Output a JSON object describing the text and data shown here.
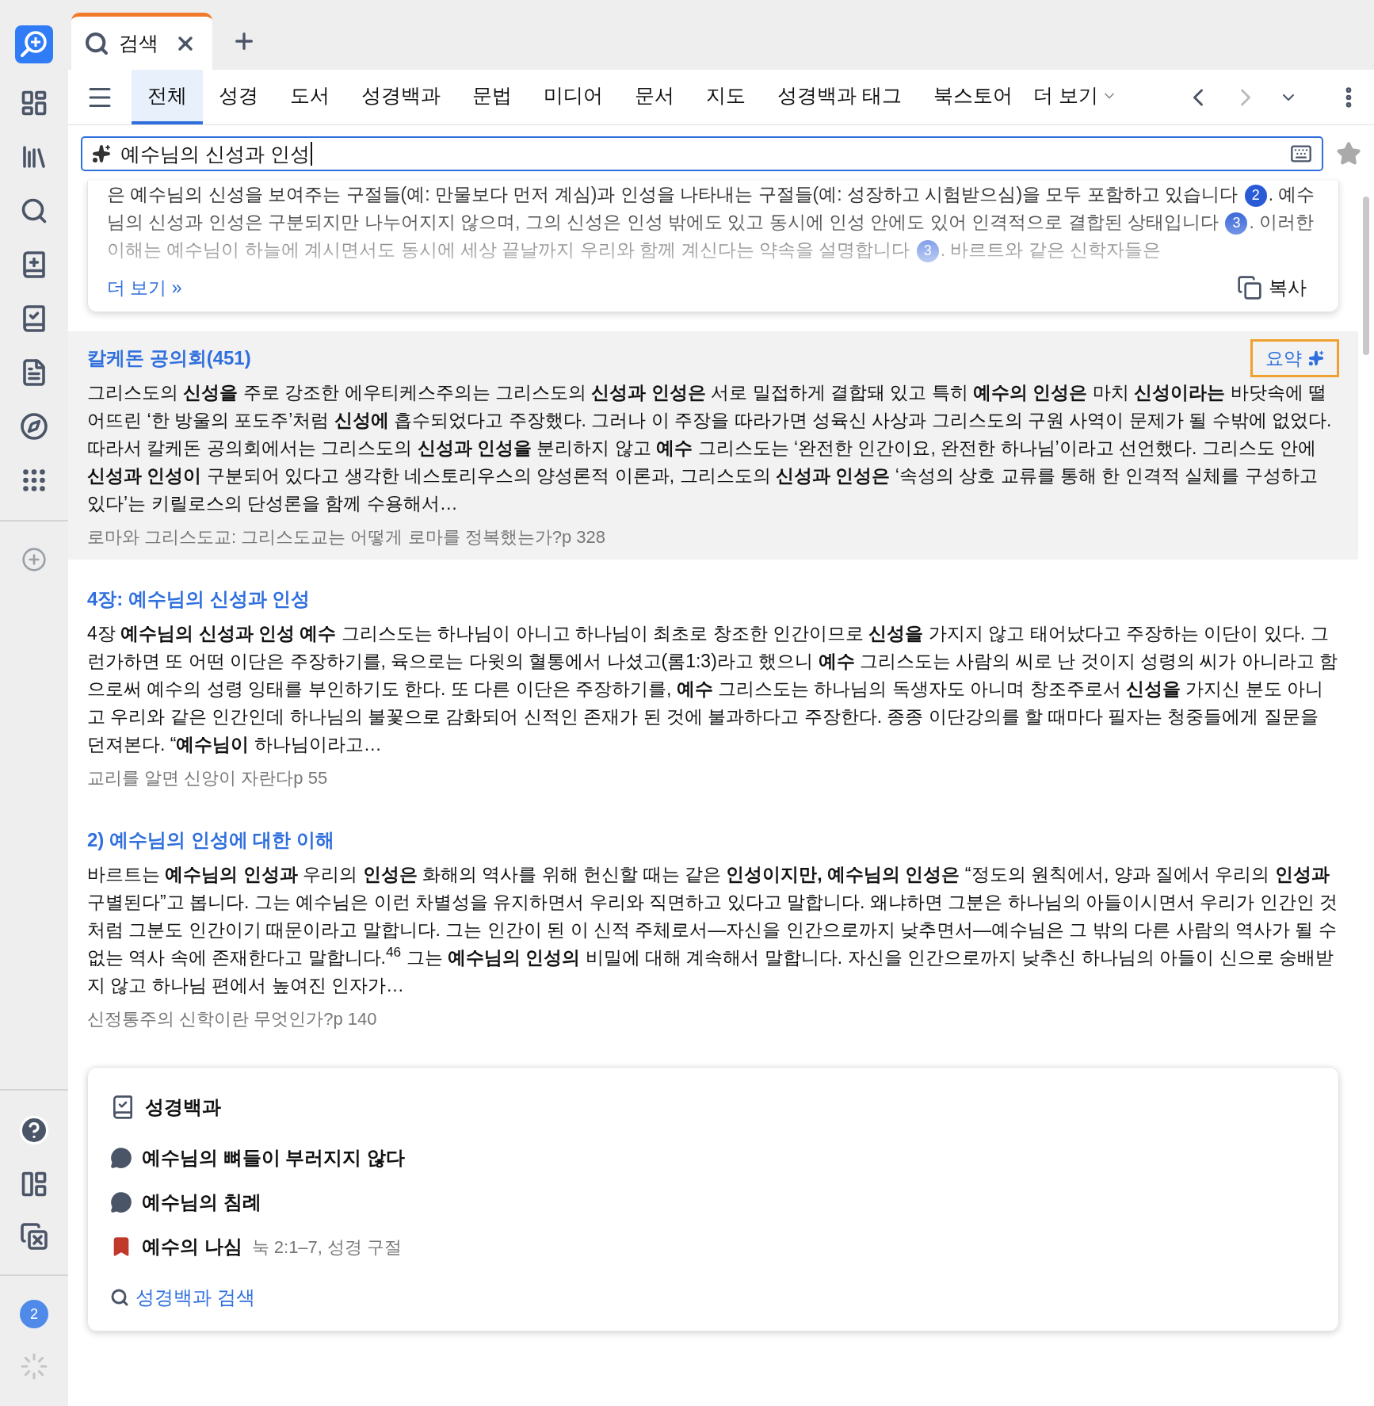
{
  "sidebar": {
    "badge": "2"
  },
  "tab": {
    "title": "검색"
  },
  "categories": [
    {
      "label": "전체",
      "selected": true
    },
    {
      "label": "성경",
      "selected": false
    },
    {
      "label": "도서",
      "selected": false
    },
    {
      "label": "성경백과",
      "selected": false
    },
    {
      "label": "문법",
      "selected": false
    },
    {
      "label": "미디어",
      "selected": false
    },
    {
      "label": "문서",
      "selected": false
    },
    {
      "label": "지도",
      "selected": false
    },
    {
      "label": "성경백과 태그",
      "selected": false
    },
    {
      "label": "북스토어",
      "selected": false
    }
  ],
  "more_tabs": "더 보기",
  "nav": {
    "back_disabled": false,
    "forward_disabled": true
  },
  "search": {
    "value": "예수님의 신성과 인성"
  },
  "summary": {
    "segments": [
      {
        "kind": "text",
        "text": "은 예수님의 신성을 보여주는 구절들(예: 만물보다 먼저 계심)과 인성을 나타내는 구절들(예: 성장하고 시험받으심)을 모두 포함하고 있습니다 "
      },
      {
        "kind": "cite",
        "text": "2"
      },
      {
        "kind": "text",
        "text": ". 예수님의 신성과 인성은 구분되지만 나누어지지 않으며, 그의 신성은 인성 밖에도 있고 동시에 인성 안에도 있어 인격적으로 결합된 상태입니다 "
      },
      {
        "kind": "cite",
        "text": "3"
      },
      {
        "kind": "text",
        "text": ". 이러한 이해는 예수님이 하늘에 계시면서도 동시에 세상 끝날까지 우리와 함께 계신다는 약속을 설명합니다 "
      },
      {
        "kind": "cite",
        "text": "3"
      },
      {
        "kind": "text",
        "text": ". 바르트와 같은 신학자들은"
      }
    ],
    "more_link": "더 보기 »",
    "copy_label": "복사"
  },
  "results": [
    {
      "title": "칼케돈 공의회(451)",
      "selected": true,
      "summary_button": "요약",
      "snippet": "그리스도의 **신성을** 주로 강조한 에우티케스주의는 그리스도의 **신성과 인성은** 서로 밀접하게 결합돼 있고 특히 **예수의 인성은** 마치 **신성이라는** 바닷속에 떨어뜨린 ‘한 방울의 포도주’처럼 **신성에** 흡수되었다고 주장했다. 그러나 이 주장을 따라가면 성육신 사상과 그리스도의 구원 사역이 문제가 될 수밖에 없었다. 따라서 칼케돈 공의회에서는 그리스도의 **신성과 인성을** 분리하지 않고 **예수** 그리스도는 ‘완전한 인간이요, 완전한 하나님’이라고 선언했다. 그리스도 안에 **신성과 인성이** 구분되어 있다고 생각한 네스토리우스의 양성론적 이론과, 그리스도의 **신성과 인성은** ‘속성의 상호 교류를 통해 한 인격적 실체를 구성하고 있다’는 키릴로스의 단성론을 함께 수용해서…",
      "source": "로마와 그리스도교: 그리스도교는 어떻게 로마를 정복했는가?p 328"
    },
    {
      "title": "4장: 예수님의 신성과 인성",
      "selected": false,
      "snippet": "4장 **예수님의 신성과 인성 예수** 그리스도는 하나님이 아니고 하나님이 최초로 창조한 인간이므로 **신성을** 가지지 않고 태어났다고 주장하는 이단이 있다. 그런가하면 또 어떤 이단은 주장하기를, 육으로는 다윗의 혈통에서 나셨고(롬1:3)라고 했으니 **예수** 그리스도는 사람의 씨로 난 것이지 성령의 씨가 아니라고 함으로써 예수의 성령 잉태를 부인하기도 한다. 또 다른 이단은 주장하기를, **예수** 그리스도는 하나님의 독생자도 아니며 창조주로서 **신성을** 가지신 분도 아니고 우리와 같은 인간인데 하나님의 불꽃으로 감화되어 신적인 존재가 된 것에 불과하다고 주장한다. 종종 이단강의를 할 때마다 필자는 청중들에게 질문을 던져본다. “**예수님이** 하나님이라고…",
      "source": "교리를 알면 신앙이 자란다p 55"
    },
    {
      "title": "2) 예수님의 인성에 대한 이해",
      "selected": false,
      "snippet": "바르트는 **예수님의 인성과** 우리의 **인성은** 화해의 역사를 위해 헌신할 때는 같은 **인성이지만, 예수님의 인성은** “정도의 원칙에서, 양과 질에서 우리의 **인성과** 구별된다”고 봅니다. 그는 예수님은 이런 차별성을 유지하면서 우리와 직면하고 있다고 말합니다. 왜냐하면 그분은 하나님의 아들이시면서 우리가 인간인 것처럼 그분도 인간이기 때문이라고 말합니다. 그는 인간이 된 이 신적 주체로서—자신을 인간으로까지 낮추면서—예수님은 그 밖의 다른 사람의 역사가 될 수 없는 역사 속에 존재한다고 말합니다.$^{46}$ 그는 **예수님의 인성의** 비밀에 대해 계속해서 말합니다. 자신을 인간으로까지 낮추신 하나님의 아들이 신으로 숭배받지 않고 하나님 편에서 높여진 인자가…",
      "source": "신정통주의 신학이란 무엇인가?p 140"
    }
  ],
  "encyclopedia": {
    "title": "성경백과",
    "items": [
      {
        "kind": "topic",
        "label": "예수님의 뼈들이 부러지지 않다"
      },
      {
        "kind": "topic",
        "label": "예수님의 침례"
      },
      {
        "kind": "passage",
        "label": "예수의 나심",
        "detail": "눅 2:1–7, 성경 구절"
      }
    ],
    "search_link": "성경백과 검색"
  }
}
